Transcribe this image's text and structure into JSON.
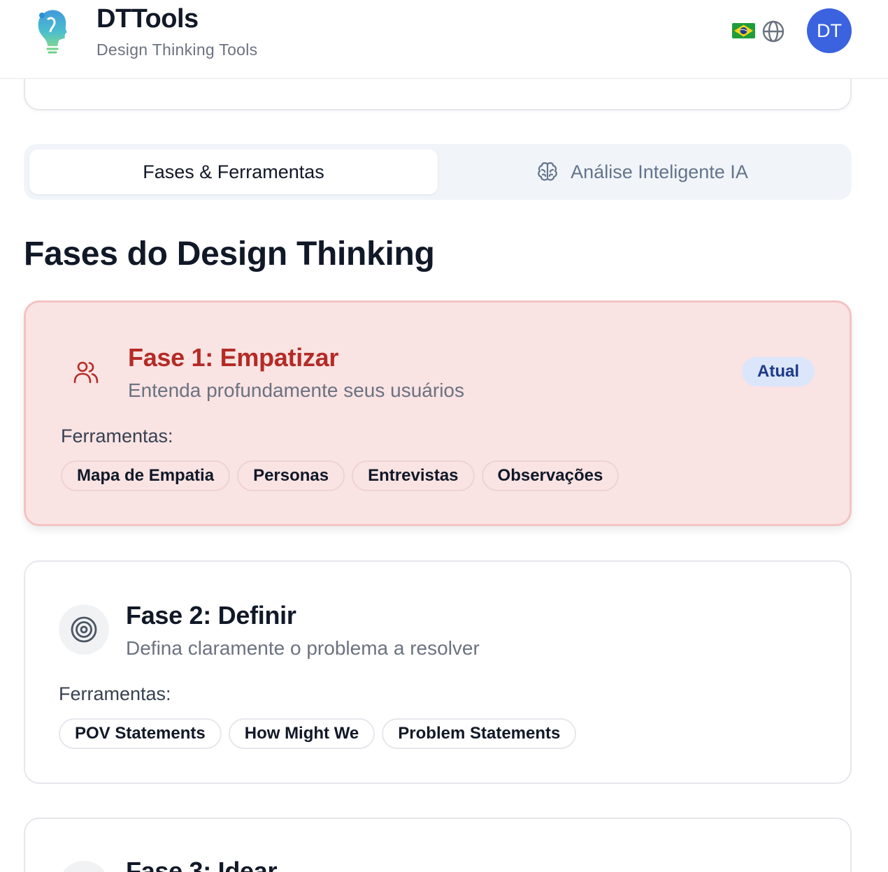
{
  "header": {
    "title": "DTTools",
    "subtitle": "Design Thinking Tools",
    "language_flag": "brazil-flag",
    "language_icon": "globe-icon",
    "avatar_initials": "DT",
    "avatar_color": "#3b63e0"
  },
  "tabs": [
    {
      "label": "Fases & Ferramentas",
      "active": true
    },
    {
      "label": "Análise Inteligente IA",
      "active": false,
      "icon": "brain-icon"
    }
  ],
  "section_title": "Fases do Design Thinking",
  "phases": [
    {
      "title": "Fase 1: Empatizar",
      "description": "Entenda profundamente seus usuários",
      "badge": "Atual",
      "tools_label": "Ferramentas:",
      "tools": [
        "Mapa de Empatia",
        "Personas",
        "Entrevistas",
        "Observações"
      ],
      "icon": "users-icon",
      "accent": "#b42b26"
    },
    {
      "title": "Fase 2: Definir",
      "description": "Defina claramente o problema a resolver",
      "tools_label": "Ferramentas:",
      "tools": [
        "POV Statements",
        "How Might We",
        "Problem Statements"
      ],
      "icon": "target-icon"
    },
    {
      "title": "Fase 3: Idear"
    }
  ]
}
